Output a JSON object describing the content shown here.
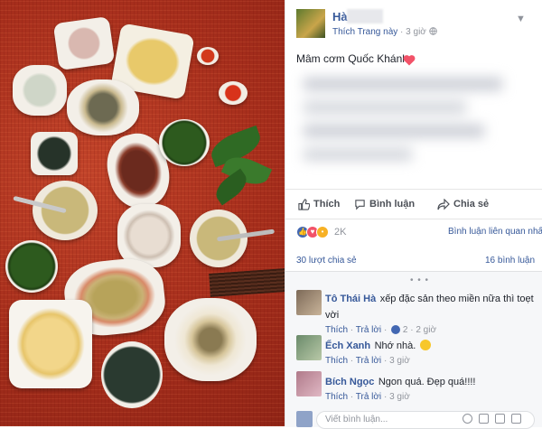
{
  "post": {
    "author": "Hà",
    "page_link": "Thích Trang này",
    "separator": "·",
    "time": "3 giờ",
    "caption": "Mâm cơm Quốc Khánh"
  },
  "actions": {
    "like": "Thích",
    "comment": "Bình luận",
    "share": "Chia sẻ"
  },
  "reactions": {
    "count": "2K",
    "sort_label": "Bình luận liên quan nhất ▾",
    "types": [
      "like",
      "love",
      "wow"
    ]
  },
  "stats": {
    "shares": "30 lượt chia sẻ",
    "comments": "16 bình luận"
  },
  "comments": [
    {
      "name": "Tô Thái Hà",
      "text": "xếp đặc sản theo miền nữa thì toẹt vời",
      "like": "Thích",
      "reply": "Trả lời",
      "likes": "2",
      "time": "2 giờ"
    },
    {
      "name": "Ếch Xanh",
      "text": "Nhớ nhà.",
      "like": "Thích",
      "reply": "Trả lời",
      "time": "3 giờ"
    },
    {
      "name": "Bích Ngọc",
      "text": "Ngon quá. Đẹp quá!!!!",
      "like": "Thích",
      "reply": "Trả lời",
      "time": "3 giờ"
    }
  ],
  "reply": {
    "placeholder": "Viết bình luận..."
  },
  "more_dots": "• • •",
  "colors": {
    "link": "#365899",
    "tablecloth": "#b3321f",
    "love": "#f25268",
    "like": "#4267b2"
  },
  "icons": [
    "thumbs-up-icon",
    "comment-icon",
    "share-icon",
    "globe-icon",
    "chevron-down-icon",
    "heart-icon",
    "smile-icon",
    "camera-icon",
    "gif-icon",
    "sticker-icon"
  ]
}
